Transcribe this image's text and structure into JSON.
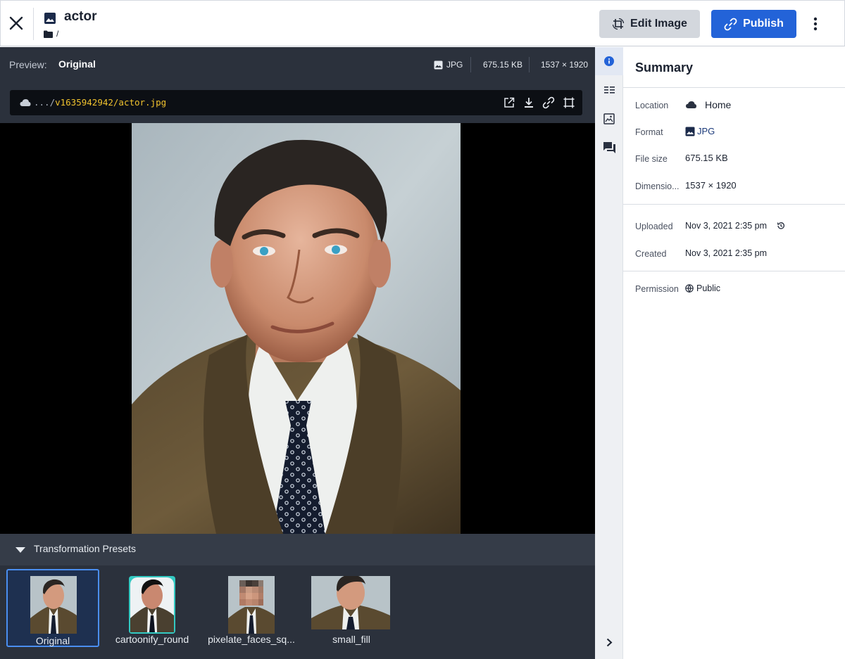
{
  "header": {
    "asset_name": "actor",
    "folder_path": "/",
    "edit_label": "Edit Image",
    "publish_label": "Publish",
    "icons": {
      "close": "close-icon",
      "asset": "image-icon",
      "folder": "folder-icon",
      "edit": "crop-rotate-icon",
      "publish": "link-icon",
      "more": "more-vertical-icon"
    }
  },
  "preview": {
    "label": "Preview:",
    "value": "Original",
    "format": "JPG",
    "file_size": "675.15 KB",
    "dimensions": "1537 × 1920"
  },
  "url": {
    "prefix": ".../",
    "path": "v1635942942/actor.jpg",
    "actions": [
      "open-external-icon",
      "download-icon",
      "link-icon",
      "crop-icon"
    ]
  },
  "presets": {
    "title": "Transformation Presets",
    "items": [
      {
        "label": "Original",
        "selected": true
      },
      {
        "label": "cartoonify_round",
        "selected": false
      },
      {
        "label": "pixelate_faces_sq...",
        "selected": false
      },
      {
        "label": "small_fill",
        "selected": false
      }
    ]
  },
  "rail": {
    "items": [
      "info-icon",
      "list-icon",
      "image-analysis-icon",
      "comments-icon"
    ],
    "expand": "chevron-right-icon"
  },
  "summary": {
    "title": "Summary",
    "location": {
      "label": "Location",
      "value": "Home"
    },
    "format": {
      "label": "Format",
      "value": "JPG"
    },
    "file_size": {
      "label": "File size",
      "value": "675.15 KB"
    },
    "dimensions": {
      "label": "Dimensio...",
      "value": "1537 × 1920"
    },
    "uploaded": {
      "label": "Uploaded",
      "value": "Nov 3, 2021 2:35 pm"
    },
    "created": {
      "label": "Created",
      "value": "Nov 3, 2021 2:35 pm"
    },
    "permission": {
      "label": "Permission",
      "value": "Public"
    }
  },
  "colors": {
    "accent": "#2363d8",
    "dark_bg": "#2b313c",
    "url_highlight": "#f0c22e"
  }
}
